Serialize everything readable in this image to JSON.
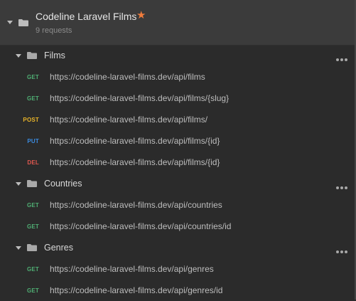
{
  "collection": {
    "name": "Codeline Laravel Films",
    "subtitle": "9 requests"
  },
  "colors": {
    "GET": "#4fae73",
    "POST": "#e8b329",
    "PUT": "#3b8be0",
    "DEL": "#e0574f",
    "star": "#f07c3c"
  },
  "folders": [
    {
      "name": "Films",
      "requests": [
        {
          "method": "GET",
          "url": "https://codeline-laravel-films.dev/api/films"
        },
        {
          "method": "GET",
          "url": "https://codeline-laravel-films.dev/api/films/{slug}"
        },
        {
          "method": "POST",
          "url": "https://codeline-laravel-films.dev/api/films/"
        },
        {
          "method": "PUT",
          "url": "https://codeline-laravel-films.dev/api/films/{id}"
        },
        {
          "method": "DEL",
          "url": "https://codeline-laravel-films.dev/api/films/{id}"
        }
      ]
    },
    {
      "name": "Countries",
      "requests": [
        {
          "method": "GET",
          "url": "https://codeline-laravel-films.dev/api/countries"
        },
        {
          "method": "GET",
          "url": "https://codeline-laravel-films.dev/api/countries/id"
        }
      ]
    },
    {
      "name": "Genres",
      "requests": [
        {
          "method": "GET",
          "url": "https://codeline-laravel-films.dev/api/genres"
        },
        {
          "method": "GET",
          "url": "https://codeline-laravel-films.dev/api/genres/id"
        }
      ]
    }
  ]
}
